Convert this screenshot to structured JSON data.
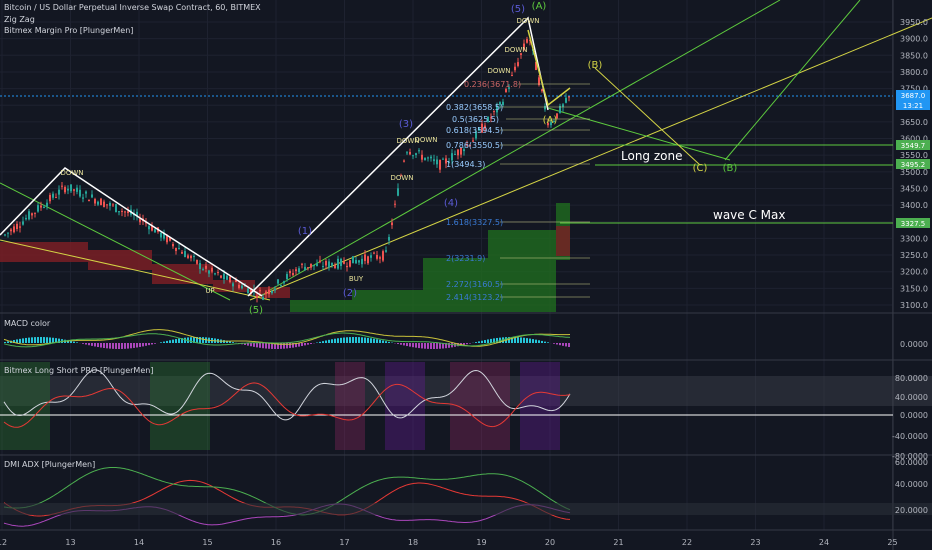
{
  "header": {
    "title": "Bitcoin / US Dollar Perpetual Inverse Swap Contract, 60, BITMEX",
    "indicators": [
      "Zig Zag",
      "Bitmex Margin Pro [PlungerMen]"
    ]
  },
  "panes": {
    "macd": "MACD color",
    "long_short": "Bitmex Long Short PRO [PlungerMen]",
    "dmi": "DMI ADX [PlungerMen]"
  },
  "price_axis": [
    "3950.0",
    "3900.0",
    "3850.0",
    "3800.0",
    "3750.0",
    "3700.0",
    "3650.0",
    "3600.0",
    "3550.0",
    "3500.0",
    "3450.0",
    "3400.0",
    "3350.0",
    "3300.0",
    "3250.0",
    "3200.0",
    "3150.0",
    "3100.0"
  ],
  "price_tags": [
    {
      "text": "3687.0",
      "color": "#2196f3"
    },
    {
      "text": "13:21",
      "color": "#2196f3"
    },
    {
      "text": "3549.7",
      "color": "#4caf50"
    },
    {
      "text": "3495.2",
      "color": "#4caf50"
    },
    {
      "text": "3327.5",
      "color": "#4caf50"
    }
  ],
  "macd_axis": [
    "0.0000"
  ],
  "ls_axis": [
    "80.0000",
    "40.0000",
    "0.0000",
    "-40.0000",
    "-80.0000"
  ],
  "dmi_axis": [
    "60.0000",
    "40.0000",
    "20.0000"
  ],
  "time_axis": [
    "12",
    "13",
    "14",
    "15",
    "16",
    "17",
    "18",
    "19",
    "20",
    "21",
    "22",
    "23",
    "24",
    "25"
  ],
  "fib_levels": [
    "0.236(3671.8)",
    "0.382(3658.5)",
    "0.5(3625.5)",
    "0.618(3594.5)",
    "0.786(3550.5)",
    "1(3494.3)",
    "1.618(3327.5)",
    "2(3231.9)",
    "2.272(3160.5)",
    "2.414(3123.2)"
  ],
  "wave_labels": [
    "(5)",
    "(A)",
    "(B)",
    "(A)",
    "(C)",
    "(B)",
    "(3)",
    "(4)",
    "(1)",
    "(2)",
    "(5)"
  ],
  "signal_labels": [
    "DOWN",
    "DOWN",
    "DOWN",
    "DOWN",
    "DOWN",
    "DOWN",
    "DOWN",
    "UP",
    "BUY"
  ],
  "annotations": {
    "long_zone": "Long zone",
    "wave_c_max": "wave C Max"
  },
  "colors": {
    "up": "#26a69a",
    "down": "#ef5350",
    "yellow": "#d4d445",
    "green": "#5dca3e",
    "white": "#ffffff",
    "wave_blue": "#5b5bd6"
  }
}
